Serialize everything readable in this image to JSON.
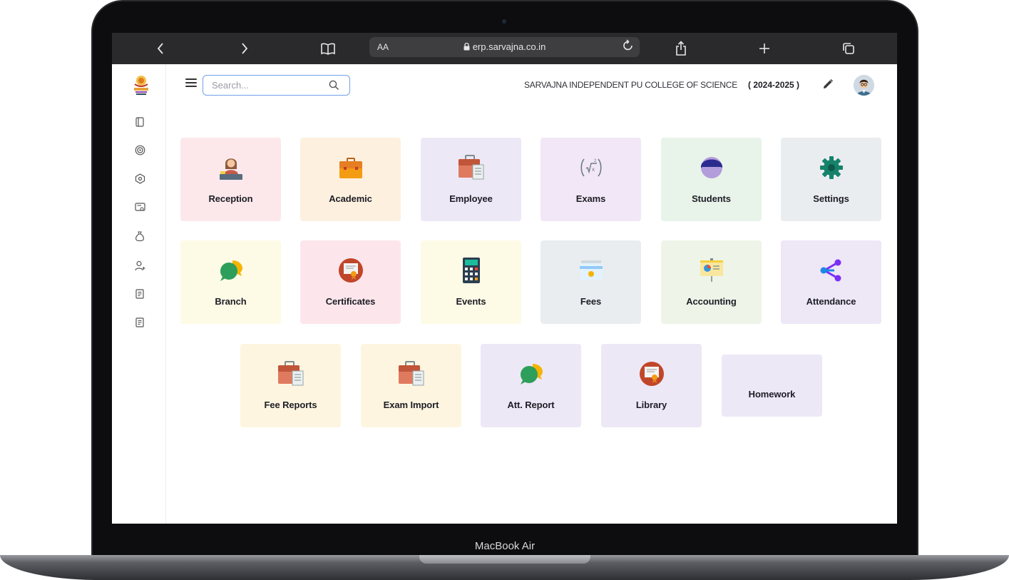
{
  "device": {
    "label": "MacBook Air"
  },
  "browser": {
    "aa_label": "AA",
    "url": "erp.sarvajna.co.in"
  },
  "header": {
    "search_placeholder": "Search...",
    "college_name": "SARVAJNA INDEPENDENT PU COLLEGE OF SCIENCE",
    "academic_year": "( 2024-2025 )"
  },
  "sidebar": {
    "items": [
      {
        "icon": "notebook-icon"
      },
      {
        "icon": "target-icon"
      },
      {
        "icon": "hexagon-settings-icon"
      },
      {
        "icon": "certificate-card-icon"
      },
      {
        "icon": "money-bag-icon"
      },
      {
        "icon": "add-user-icon"
      },
      {
        "icon": "receipt-icon"
      },
      {
        "icon": "receipt-icon"
      }
    ]
  },
  "tiles": [
    {
      "label": "Reception",
      "color": "#fce8ea",
      "icon": "receptionist-icon"
    },
    {
      "label": "Academic",
      "color": "#fdf0df",
      "icon": "briefcase-icon"
    },
    {
      "label": "Employee",
      "color": "#ece8f6",
      "icon": "briefcase-document-icon"
    },
    {
      "label": "Exams",
      "color": "#f2e7f6",
      "icon": "formula-icon"
    },
    {
      "label": "Students",
      "color": "#e8f4ea",
      "icon": "student-icon"
    },
    {
      "label": "Settings",
      "color": "#eaedf0",
      "icon": "gear-icon"
    },
    {
      "label": "Branch",
      "color": "#fdfae6",
      "icon": "chat-bubbles-icon"
    },
    {
      "label": "Certificates",
      "color": "#fce6ec",
      "icon": "certificate-icon"
    },
    {
      "label": "Events",
      "color": "#fdfae6",
      "icon": "calculator-icon"
    },
    {
      "label": "Fees",
      "color": "#eaedf0",
      "icon": "cash-register-icon"
    },
    {
      "label": "Accounting",
      "color": "#eef4e8",
      "icon": "presentation-chart-icon"
    },
    {
      "label": "Attendance",
      "color": "#ede7f6",
      "icon": "share-network-icon"
    },
    {
      "label": "Fee Reports",
      "color": "#fdf5e0",
      "icon": "briefcase-document-icon"
    },
    {
      "label": "Exam Import",
      "color": "#fdf5e0",
      "icon": "briefcase-document-icon"
    },
    {
      "label": "Att. Report",
      "color": "#ede8f6",
      "icon": "chat-bubbles-icon"
    },
    {
      "label": "Library",
      "color": "#ede8f6",
      "icon": "certificate-icon"
    },
    {
      "label": "Homework",
      "color": "#ede8f6",
      "icon": ""
    }
  ]
}
